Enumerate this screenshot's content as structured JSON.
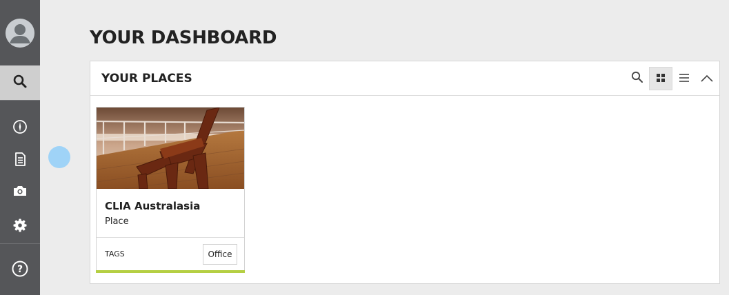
{
  "page": {
    "title": "YOUR DASHBOARD"
  },
  "sidebar": {
    "items": [
      {
        "icon": "user-avatar-icon"
      },
      {
        "icon": "search-icon",
        "active": true
      },
      {
        "icon": "compass-icon"
      },
      {
        "icon": "document-icon"
      },
      {
        "icon": "camera-icon"
      },
      {
        "icon": "gear-icon"
      },
      {
        "icon": "help-icon"
      }
    ]
  },
  "panel": {
    "title": "YOUR PLACES",
    "controls": [
      {
        "icon": "search-icon"
      },
      {
        "icon": "grid-view-icon",
        "active": true
      },
      {
        "icon": "list-view-icon"
      },
      {
        "icon": "collapse-chevron-up-icon"
      }
    ],
    "places": [
      {
        "name": "CLIA Australasia",
        "type": "Place",
        "tags_label": "TAGS",
        "tags": [
          "Office"
        ],
        "accent_color": "#b5cf43"
      }
    ]
  },
  "colors": {
    "sidebar": "#555659",
    "sidebar_active": "#cfcfcf",
    "background": "#ececec",
    "accent": "#b5cf43",
    "cursor": "#9fd3f7"
  }
}
